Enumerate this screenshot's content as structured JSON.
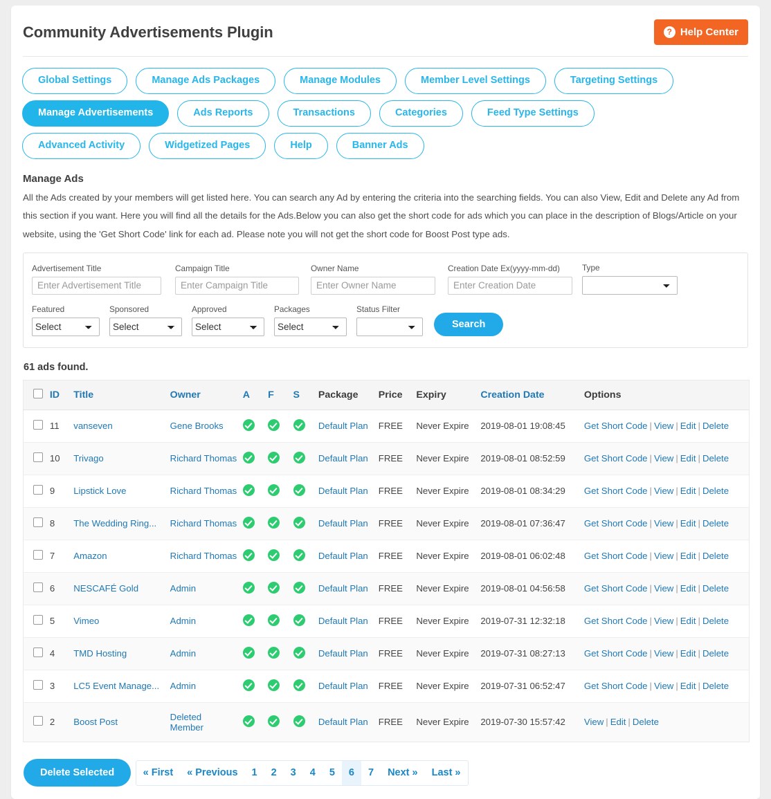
{
  "header": {
    "title": "Community Advertisements Plugin",
    "help_button": "Help Center",
    "help_icon_glyph": "?"
  },
  "tabs": [
    {
      "label": "Global Settings",
      "active": false
    },
    {
      "label": "Manage Ads Packages",
      "active": false
    },
    {
      "label": "Manage Modules",
      "active": false
    },
    {
      "label": "Member Level Settings",
      "active": false
    },
    {
      "label": "Targeting Settings",
      "active": false
    },
    {
      "label": "Manage Advertisements",
      "active": true
    },
    {
      "label": "Ads Reports",
      "active": false
    },
    {
      "label": "Transactions",
      "active": false
    },
    {
      "label": "Categories",
      "active": false
    },
    {
      "label": "Feed Type Settings",
      "active": false
    },
    {
      "label": "Advanced Activity",
      "active": false
    },
    {
      "label": "Widgetized Pages",
      "active": false
    },
    {
      "label": "Help",
      "active": false
    },
    {
      "label": "Banner Ads",
      "active": false
    }
  ],
  "section": {
    "title": "Manage Ads",
    "description": "All the Ads created by your members will get listed here. You can search any Ad by entering the criteria into the searching fields. You can also View, Edit and Delete any Ad from this section if you want. Here you will find all the details for the Ads.Below you can also get the short code for ads which you can place in the description of Blogs/Article on your website, using the 'Get Short Code' link for each ad. Please note you will not get the short code for Boost Post type ads."
  },
  "filters": {
    "advertisement_title": {
      "label": "Advertisement Title",
      "placeholder": "Enter Advertisement Title",
      "value": ""
    },
    "campaign_title": {
      "label": "Campaign Title",
      "placeholder": "Enter Campaign Title",
      "value": ""
    },
    "owner_name": {
      "label": "Owner Name",
      "placeholder": "Enter Owner Name",
      "value": ""
    },
    "creation_date": {
      "label": "Creation Date Ex(yyyy-mm-dd)",
      "placeholder": "Enter Creation Date",
      "value": ""
    },
    "type": {
      "label": "Type",
      "selected": ""
    },
    "featured": {
      "label": "Featured",
      "selected": "Select"
    },
    "sponsored": {
      "label": "Sponsored",
      "selected": "Select"
    },
    "approved": {
      "label": "Approved",
      "selected": "Select"
    },
    "packages": {
      "label": "Packages",
      "selected": "Select"
    },
    "status_filter": {
      "label": "Status Filter",
      "selected": ""
    },
    "search_button": "Search"
  },
  "results": {
    "count_text": "61 ads found.",
    "columns": {
      "id": "ID",
      "title": "Title",
      "owner": "Owner",
      "a": "A",
      "f": "F",
      "s": "S",
      "package": "Package",
      "price": "Price",
      "expiry": "Expiry",
      "creation_date": "Creation Date",
      "options": "Options"
    },
    "option_labels": {
      "get_short_code": "Get Short Code",
      "view": "View",
      "edit": "Edit",
      "delete": "Delete",
      "separator": "|"
    },
    "rows": [
      {
        "id": "11",
        "title": "vanseven",
        "owner": "Gene Brooks",
        "a": true,
        "f": true,
        "s": true,
        "package": "Default Plan",
        "price": "FREE",
        "expiry": "Never Expire",
        "creation_date": "2019-08-01 19:08:45",
        "has_short_code": true
      },
      {
        "id": "10",
        "title": "Trivago",
        "owner": "Richard Thomas",
        "a": true,
        "f": true,
        "s": true,
        "package": "Default Plan",
        "price": "FREE",
        "expiry": "Never Expire",
        "creation_date": "2019-08-01 08:52:59",
        "has_short_code": true
      },
      {
        "id": "9",
        "title": "Lipstick Love",
        "owner": "Richard Thomas",
        "a": true,
        "f": true,
        "s": true,
        "package": "Default Plan",
        "price": "FREE",
        "expiry": "Never Expire",
        "creation_date": "2019-08-01 08:34:29",
        "has_short_code": true
      },
      {
        "id": "8",
        "title": "The Wedding Ring...",
        "owner": "Richard Thomas",
        "a": true,
        "f": true,
        "s": true,
        "package": "Default Plan",
        "price": "FREE",
        "expiry": "Never Expire",
        "creation_date": "2019-08-01 07:36:47",
        "has_short_code": true
      },
      {
        "id": "7",
        "title": "Amazon",
        "owner": "Richard Thomas",
        "a": true,
        "f": true,
        "s": true,
        "package": "Default Plan",
        "price": "FREE",
        "expiry": "Never Expire",
        "creation_date": "2019-08-01 06:02:48",
        "has_short_code": true
      },
      {
        "id": "6",
        "title": "NESCAFÉ Gold",
        "owner": "Admin",
        "a": true,
        "f": true,
        "s": true,
        "package": "Default Plan",
        "price": "FREE",
        "expiry": "Never Expire",
        "creation_date": "2019-08-01 04:56:58",
        "has_short_code": true
      },
      {
        "id": "5",
        "title": "Vimeo",
        "owner": "Admin",
        "a": true,
        "f": true,
        "s": true,
        "package": "Default Plan",
        "price": "FREE",
        "expiry": "Never Expire",
        "creation_date": "2019-07-31 12:32:18",
        "has_short_code": true
      },
      {
        "id": "4",
        "title": "TMD Hosting",
        "owner": "Admin",
        "a": true,
        "f": true,
        "s": true,
        "package": "Default Plan",
        "price": "FREE",
        "expiry": "Never Expire",
        "creation_date": "2019-07-31 08:27:13",
        "has_short_code": true
      },
      {
        "id": "3",
        "title": "LC5 Event Manage...",
        "owner": "Admin",
        "a": true,
        "f": true,
        "s": true,
        "package": "Default Plan",
        "price": "FREE",
        "expiry": "Never Expire",
        "creation_date": "2019-07-31 06:52:47",
        "has_short_code": true
      },
      {
        "id": "2",
        "title": "Boost Post",
        "owner": "Deleted Member",
        "a": true,
        "f": true,
        "s": true,
        "package": "Default Plan",
        "price": "FREE",
        "expiry": "Never Expire",
        "creation_date": "2019-07-30 15:57:42",
        "has_short_code": false
      }
    ]
  },
  "footer": {
    "delete_selected": "Delete Selected",
    "pagination": [
      {
        "label": "« First",
        "active": false
      },
      {
        "label": "« Previous",
        "active": false
      },
      {
        "label": "1",
        "active": false
      },
      {
        "label": "2",
        "active": false
      },
      {
        "label": "3",
        "active": false
      },
      {
        "label": "4",
        "active": false
      },
      {
        "label": "5",
        "active": false
      },
      {
        "label": "6",
        "active": true
      },
      {
        "label": "7",
        "active": false
      },
      {
        "label": "Next »",
        "active": false
      },
      {
        "label": "Last »",
        "active": false
      }
    ]
  },
  "colors": {
    "accent_blue": "#22b5ea",
    "link_blue": "#2079b5",
    "orange": "#f26522",
    "green": "#2ecc71"
  }
}
